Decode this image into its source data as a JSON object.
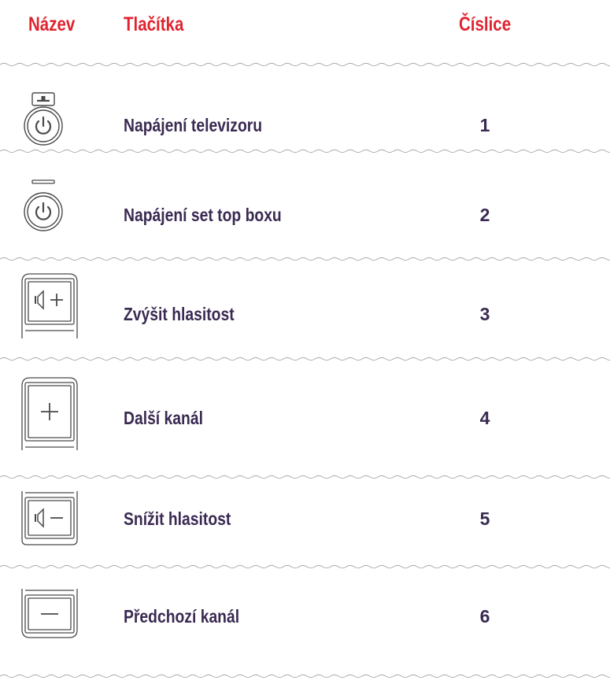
{
  "colors": {
    "header": "#e1232f",
    "text": "#3a2a52",
    "divider": "#a9a9ad",
    "icon_stroke": "#4a4a4a"
  },
  "header": {
    "name": "Název",
    "button": "Tlačítka",
    "digit": "Číslice"
  },
  "rows": [
    {
      "icon": "tv-power-icon",
      "label": "Napájení televizoru",
      "digit": "1"
    },
    {
      "icon": "stb-power-icon",
      "label": "Napájení set top boxu",
      "digit": "2"
    },
    {
      "icon": "volume-up-icon",
      "label": "Zvýšit hlasitost",
      "digit": "3"
    },
    {
      "icon": "channel-up-icon",
      "label": "Další kanál",
      "digit": "4"
    },
    {
      "icon": "volume-down-icon",
      "label": "Snížit hlasitost",
      "digit": "5"
    },
    {
      "icon": "channel-down-icon",
      "label": "Předchozí kanál",
      "digit": "6"
    }
  ]
}
